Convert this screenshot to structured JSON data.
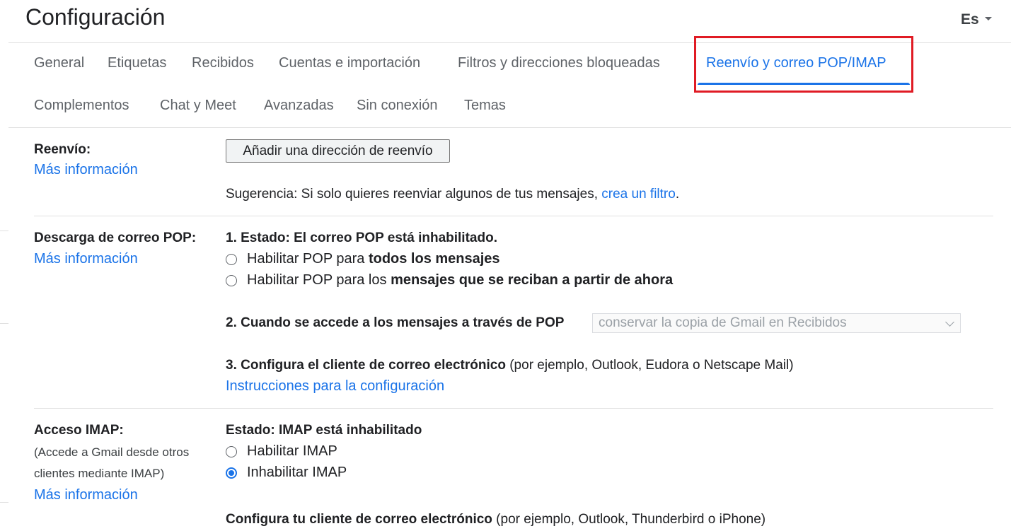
{
  "header": {
    "title": "Configuración",
    "language": "Es"
  },
  "tabs": [
    {
      "label": "General"
    },
    {
      "label": "Etiquetas"
    },
    {
      "label": "Recibidos"
    },
    {
      "label": "Cuentas e importación"
    },
    {
      "label": "Filtros y direcciones bloqueadas"
    },
    {
      "label": "Reenvío y correo POP/IMAP",
      "active": true
    },
    {
      "label": "Complementos"
    },
    {
      "label": "Chat y Meet"
    },
    {
      "label": "Avanzadas"
    },
    {
      "label": "Sin conexión"
    },
    {
      "label": "Temas"
    }
  ],
  "forwarding": {
    "label": "Reenvío:",
    "more_info": "Más información",
    "add_button": "Añadir una dirección de reenvío",
    "tip_prefix": "Sugerencia: Si solo quieres reenviar algunos de tus mensajes,",
    "tip_link": "crea un filtro",
    "tip_suffix": "."
  },
  "pop": {
    "label": "Descarga de correo POP:",
    "more_info": "Más información",
    "status": "1. Estado: El correo POP está inhabilitado.",
    "option1_prefix": "Habilitar POP para ",
    "option1_bold": "todos los mensajes",
    "option1_checked": false,
    "option2_prefix": "Habilitar POP para los ",
    "option2_bold": "mensajes que se reciban a partir de ahora",
    "option2_checked": false,
    "when_accessed": "2. Cuando se accede a los mensajes a través de POP",
    "when_accessed_selected": "conservar la copia de Gmail en Recibidos",
    "configure_bold": "3. Configura el cliente de correo electrónico",
    "configure_rest": " (por ejemplo, Outlook, Eudora o Netscape Mail)",
    "instructions_link": "Instrucciones para la configuración"
  },
  "imap": {
    "label": "Acceso IMAP:",
    "note_line1": "(Accede a Gmail desde otros",
    "note_line2": "clientes mediante IMAP)",
    "more_info": "Más información",
    "status": "Estado: IMAP está inhabilitado",
    "enable_label": "Habilitar IMAP",
    "enable_checked": false,
    "disable_label": "Inhabilitar IMAP",
    "disable_checked": true,
    "configure_bold": "Configura tu cliente de correo electrónico",
    "configure_rest": " (por ejemplo, Outlook, Thunderbird o iPhone)"
  },
  "colors": {
    "accent": "#1a73e8",
    "highlight": "#e01b24",
    "text": "#202124",
    "tab_text": "#5f6368"
  }
}
